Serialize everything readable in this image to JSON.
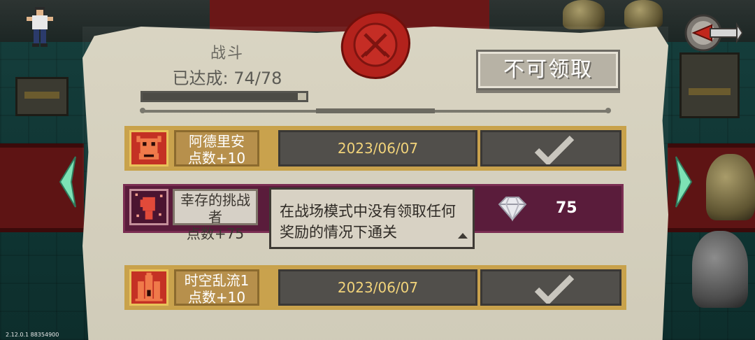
{
  "panel": {
    "title": "战斗",
    "progress_text": "已达成: 74/78",
    "progress": {
      "current": 74,
      "total": 78
    },
    "claim_button": "不可领取"
  },
  "achievements": [
    {
      "name": "阿德里安",
      "points": "点数+10",
      "date": "2023/06/07",
      "status_icon": "checkmark-icon",
      "achievement_icon": "demon-face-icon"
    },
    {
      "name": "幸存的挑战者",
      "points": "点数+75",
      "description": "在战场模式中没有领取任何奖励的情况下通关",
      "reward_icon": "diamond-gem-icon",
      "reward_count": "75",
      "achievement_icon": "fist-icon"
    },
    {
      "name": "时空乱流1",
      "points": "点数+10",
      "date": "2023/06/07",
      "status_icon": "checkmark-icon",
      "achievement_icon": "castle-tower-icon"
    }
  ],
  "version": "2.12.0.1 88354900",
  "colors": {
    "panel_bg": "#d7d2bf",
    "row_gold_border": "#c8a24a",
    "row_purple": "#5a1c3b",
    "date_text": "#f1d37a",
    "seal_red": "#b3221c"
  }
}
